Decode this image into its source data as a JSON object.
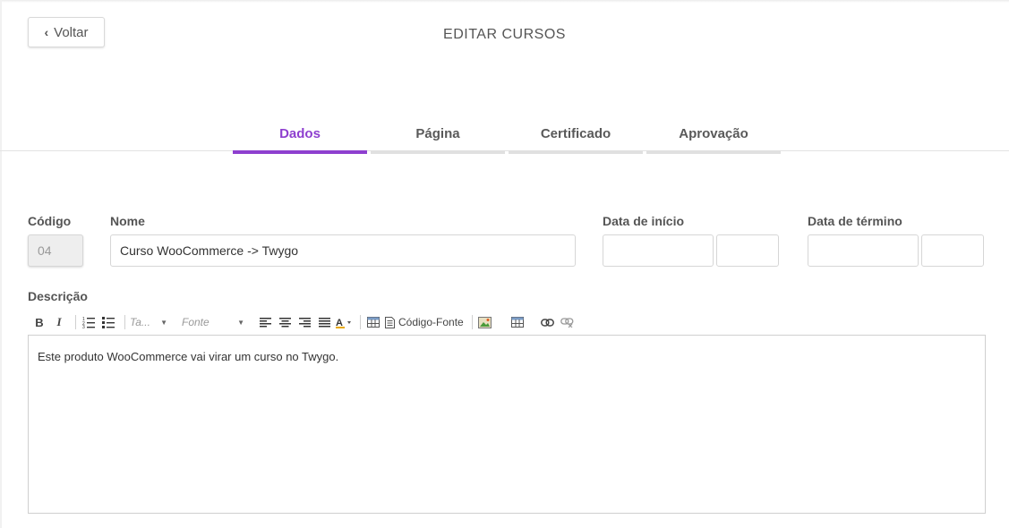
{
  "header": {
    "back_label": "Voltar",
    "title": "EDITAR CURSOS"
  },
  "tabs": [
    {
      "label": "Dados",
      "active": true
    },
    {
      "label": "Página",
      "active": false
    },
    {
      "label": "Certificado",
      "active": false
    },
    {
      "label": "Aprovação",
      "active": false
    }
  ],
  "form": {
    "codigo_label": "Código",
    "codigo_value": "04",
    "nome_label": "Nome",
    "nome_value": "Curso WooCommerce -> Twygo",
    "data_inicio_label": "Data de início",
    "data_termino_label": "Data de término",
    "descricao_label": "Descrição"
  },
  "toolbar": {
    "bold": "B",
    "italic": "I",
    "size_combo": "Ta...",
    "font_combo": "Fonte",
    "source_label": "Código-Fonte"
  },
  "editor": {
    "content": "Este produto WooCommerce vai virar um curso no Twygo."
  },
  "colors": {
    "accent": "#8e3fcf",
    "tab_inactive_bar": "#e0e0e0"
  }
}
